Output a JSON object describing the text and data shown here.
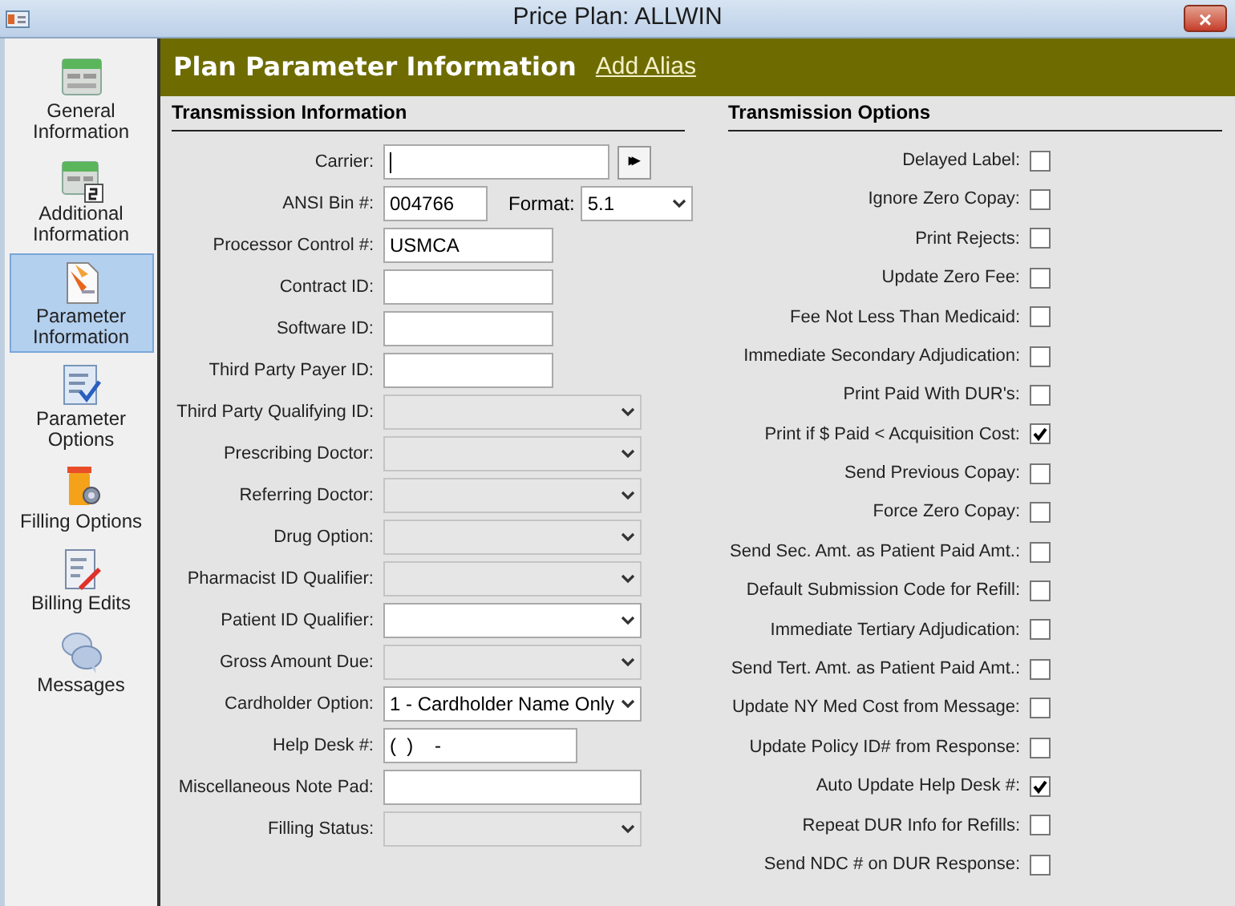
{
  "window": {
    "title": "Price Plan: ALLWIN",
    "close": "×"
  },
  "sidebar": {
    "items": [
      {
        "label": "General Information",
        "selected": false
      },
      {
        "label": "Additional Information",
        "selected": false
      },
      {
        "label": "Parameter Information",
        "selected": true
      },
      {
        "label": "Parameter Options",
        "selected": false
      },
      {
        "label": "Filling Options",
        "selected": false
      },
      {
        "label": "Billing Edits",
        "selected": false
      },
      {
        "label": "Messages",
        "selected": false
      }
    ]
  },
  "header": {
    "title": "Plan Parameter Information",
    "link": "Add Alias"
  },
  "transmission_information": {
    "title": "Transmission Information",
    "fields": [
      {
        "label": "Carrier:",
        "kind": "lookup",
        "button": "▸▸"
      },
      {
        "label": "ANSI Bin #:",
        "kind": "bin",
        "value": "004766",
        "format_label": "Format:",
        "format_value": "5.1"
      },
      {
        "label": "Processor Control #:",
        "kind": "text",
        "value": "USMCA"
      },
      {
        "label": "Contract ID:",
        "kind": "text"
      },
      {
        "label": "Software ID:",
        "kind": "text"
      },
      {
        "label": "Third Party Payer ID:",
        "kind": "text"
      },
      {
        "label": "Third Party Qualifying ID:",
        "kind": "select",
        "disabled": true
      },
      {
        "label": "Prescribing Doctor:",
        "kind": "select",
        "disabled": true
      },
      {
        "label": "Referring Doctor:",
        "kind": "select",
        "disabled": true
      },
      {
        "label": "Drug Option:",
        "kind": "select",
        "disabled": true
      },
      {
        "label": "Pharmacist ID Qualifier:",
        "kind": "select",
        "disabled": true
      },
      {
        "label": "Patient ID Qualifier:",
        "kind": "select",
        "disabled": false
      },
      {
        "label": "Gross Amount Due:",
        "kind": "select",
        "disabled": true
      },
      {
        "label": "Cardholder Option:",
        "kind": "select",
        "value": "1 - Cardholder Name Only",
        "disabled": false
      },
      {
        "label": "Help Desk #:",
        "kind": "phone",
        "value": "(  )    -"
      },
      {
        "label": "Miscellaneous Note Pad:",
        "kind": "note"
      },
      {
        "label": "Filling Status:",
        "kind": "select",
        "disabled": true
      }
    ]
  },
  "transmission_options": {
    "title": "Transmission Options",
    "options": [
      {
        "label": "Delayed Label:",
        "checked": false
      },
      {
        "label": "Ignore Zero Copay:",
        "checked": false
      },
      {
        "label": "Print Rejects:",
        "checked": false
      },
      {
        "label": "Update Zero Fee:",
        "checked": false
      },
      {
        "label": "Fee Not Less Than Medicaid:",
        "checked": false
      },
      {
        "label": "Immediate Secondary Adjudication:",
        "checked": false
      },
      {
        "label": "Print Paid With DUR's:",
        "checked": false
      },
      {
        "label": "Print if $ Paid < Acquisition Cost:",
        "checked": true
      },
      {
        "label": "Send Previous Copay:",
        "checked": false
      },
      {
        "label": "Force Zero Copay:",
        "checked": false
      },
      {
        "label": "Send Sec. Amt. as Patient Paid Amt.:",
        "checked": false
      },
      {
        "label": "Default Submission Code for Refill:",
        "checked": false
      },
      {
        "label": "Immediate Tertiary Adjudication:",
        "checked": false
      },
      {
        "label": "Send Tert. Amt. as Patient Paid Amt.:",
        "checked": false
      },
      {
        "label": "Update NY Med Cost from Message:",
        "checked": false
      },
      {
        "label": "Update Policy ID# from Response:",
        "checked": false
      },
      {
        "label": "Auto Update Help Desk #:",
        "checked": true
      },
      {
        "label": "Repeat DUR Info for Refills:",
        "checked": false
      },
      {
        "label": "Send NDC # on DUR Response:",
        "checked": false
      }
    ]
  }
}
